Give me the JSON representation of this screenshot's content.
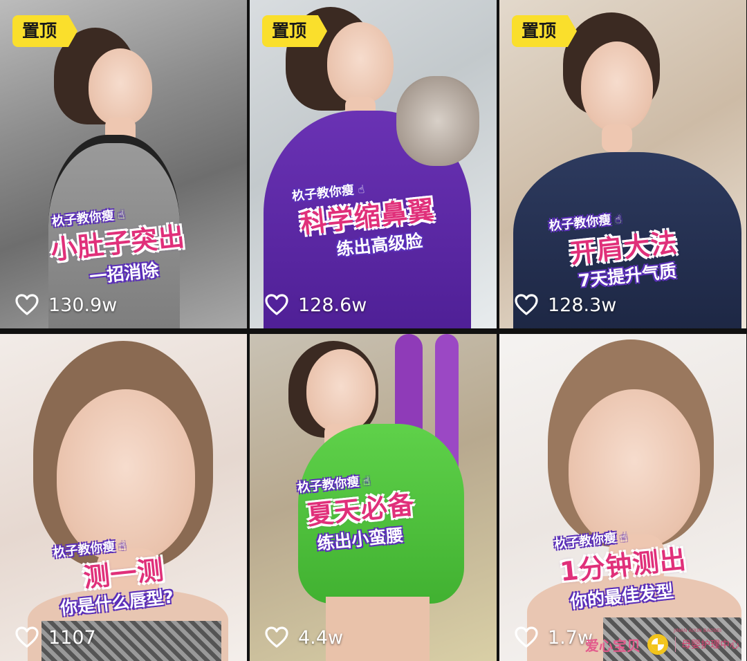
{
  "pin_label": "置顶",
  "cards": [
    {
      "brand": "杦子教你瘦",
      "title": "小肚子突出",
      "subtitle": "一招消除",
      "likes": "130.9w",
      "pinned": true
    },
    {
      "brand": "杦子教你瘦",
      "title": "科学缩鼻翼",
      "subtitle": "练出高级脸",
      "likes": "128.6w",
      "pinned": true
    },
    {
      "brand": "杦子教你瘦",
      "title": "开肩大法",
      "subtitle": "7天提升气质",
      "likes": "128.3w",
      "pinned": true
    },
    {
      "brand": "杦子教你瘦",
      "title": "测一测",
      "subtitle": "你是什么唇型?",
      "likes": "1107",
      "pinned": false
    },
    {
      "brand": "杦子教你瘦",
      "title": "夏天必备",
      "subtitle": "练出小蛮腰",
      "likes": "4.4w",
      "pinned": false
    },
    {
      "brand": "杦子教你瘦",
      "title": "1分钟测出",
      "subtitle": "你的最佳发型",
      "likes": "1.7w",
      "pinned": false
    }
  ],
  "watermark": {
    "main": "爱心宝贝",
    "sub": "母婴护理中心",
    "tiny": "JINAN AIXIN BAOBEI"
  },
  "colors": {
    "pin_bg": "#fadf2c",
    "title": "#e0307a",
    "outline": "#5a2fb8"
  },
  "icons": [
    "heart-outline-icon",
    "pointing-hand-icon",
    "sun-logo-icon"
  ]
}
